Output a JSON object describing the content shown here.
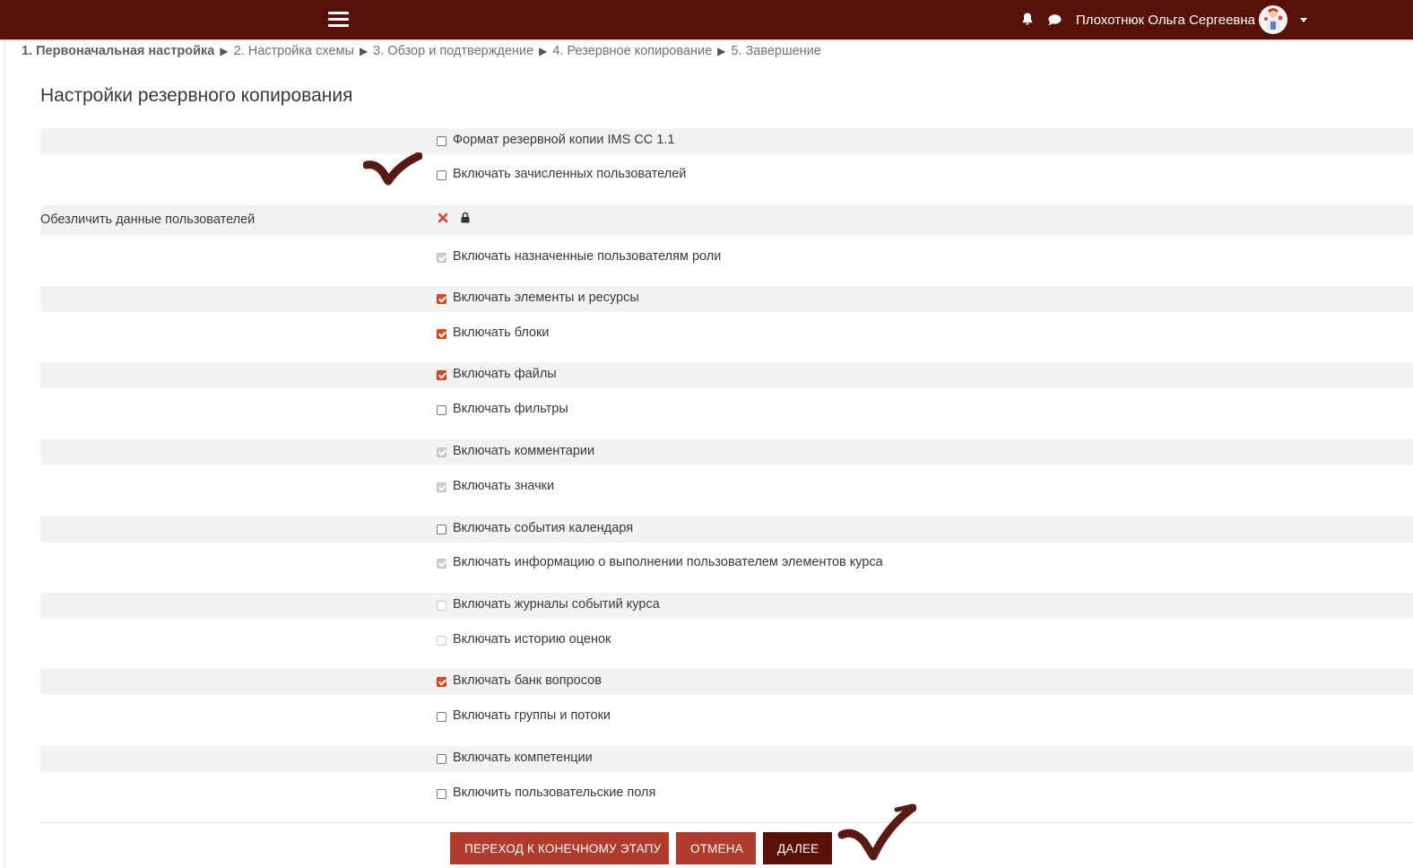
{
  "navbar": {
    "menu_icon": "hamburger-menu-icon",
    "notifications_icon": "bell-icon",
    "messages_icon": "chat-bubble-icon",
    "user_name": "Плохотнюк Ольга Сергеевна",
    "avatar_icon": "user-avatar-icon",
    "dropdown_icon": "caret-down-icon",
    "background_color": "#561108"
  },
  "breadcrumb": {
    "separator": "▶",
    "steps": [
      "1. Первоначальная настройка",
      "2. Настройка схемы",
      "3. Обзор и подтверждение",
      "4. Резервное копирование",
      "5. Завершение"
    ]
  },
  "page": {
    "title": "Настройки резервного копирования"
  },
  "settings": [
    {
      "label": "",
      "option": "Формат резервной копии IMS CC 1.1",
      "state": "unchecked"
    },
    {
      "label": "",
      "option": "Включать зачисленных пользователей",
      "state": "unchecked"
    },
    {
      "label": "Обезличить данные пользователей",
      "option": "",
      "state": "locked-no"
    },
    {
      "label": "",
      "option": "Включать назначенные пользователям роли",
      "state": "disabled-checked"
    },
    {
      "label": "",
      "option": "Включать элементы и ресурсы",
      "state": "checked"
    },
    {
      "label": "",
      "option": "Включать блоки",
      "state": "checked"
    },
    {
      "label": "",
      "option": "Включать файлы",
      "state": "checked"
    },
    {
      "label": "",
      "option": "Включать фильтры",
      "state": "unchecked"
    },
    {
      "label": "",
      "option": "Включать комментарии",
      "state": "disabled-checked"
    },
    {
      "label": "",
      "option": "Включать значки",
      "state": "disabled-checked"
    },
    {
      "label": "",
      "option": "Включать события календаря",
      "state": "unchecked"
    },
    {
      "label": "",
      "option": "Включать информацию о выполнении пользователем элементов курса",
      "state": "disabled-checked"
    },
    {
      "label": "",
      "option": "Включать журналы событий курса",
      "state": "disabled"
    },
    {
      "label": "",
      "option": "Включать историю оценок",
      "state": "disabled"
    },
    {
      "label": "",
      "option": "Включать банк вопросов",
      "state": "checked"
    },
    {
      "label": "",
      "option": "Включать группы и потоки",
      "state": "unchecked"
    },
    {
      "label": "",
      "option": "Включать компетенции",
      "state": "unchecked"
    },
    {
      "label": "",
      "option": "Включить пользовательские поля",
      "state": "unchecked"
    }
  ],
  "buttons": {
    "skip_to_final": "Переход к конечному этапу",
    "cancel": "Отмена",
    "next": "Далее"
  },
  "colors": {
    "accent": "#dd4b1e",
    "secondary_button": "#b03c2e",
    "primary_button": "#5a1208",
    "annotation_mark": "#5a1a14"
  }
}
